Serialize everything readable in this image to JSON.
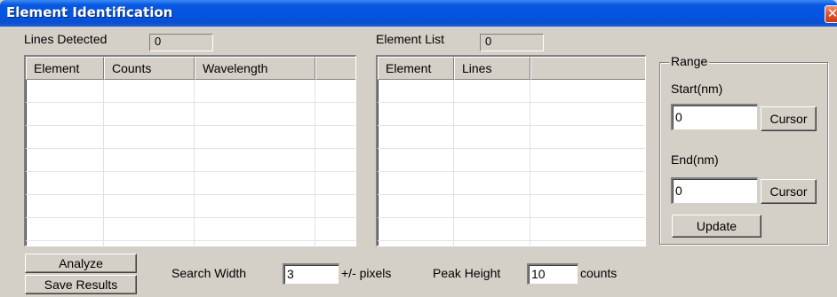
{
  "window": {
    "title": "Element Identification",
    "close_glyph": "✕",
    "close_icon": "close-icon"
  },
  "lines_detected": {
    "label": "Lines Detected",
    "value": "0"
  },
  "lines_table": {
    "columns": [
      "Element",
      "Counts",
      "Wavelength",
      ""
    ]
  },
  "element_list": {
    "label": "Element List",
    "value": "0"
  },
  "element_table": {
    "columns": [
      "Element",
      "Lines",
      ""
    ]
  },
  "range": {
    "legend": "Range",
    "start_label": "Start(nm)",
    "start_value": "0",
    "end_label": "End(nm)",
    "end_value": "0",
    "cursor_label": "Cursor",
    "update_label": "Update"
  },
  "buttons": {
    "analyze": "Analyze",
    "save_results": "Save Results"
  },
  "search_width": {
    "label": "Search Width",
    "value": "3",
    "unit": "+/- pixels"
  },
  "peak_height": {
    "label": "Peak Height",
    "value": "10",
    "unit": "counts"
  },
  "colors": {
    "title_bar": "#0454e4",
    "dialog_bg": "#d4d0c8",
    "close_button": "#e0562c"
  }
}
